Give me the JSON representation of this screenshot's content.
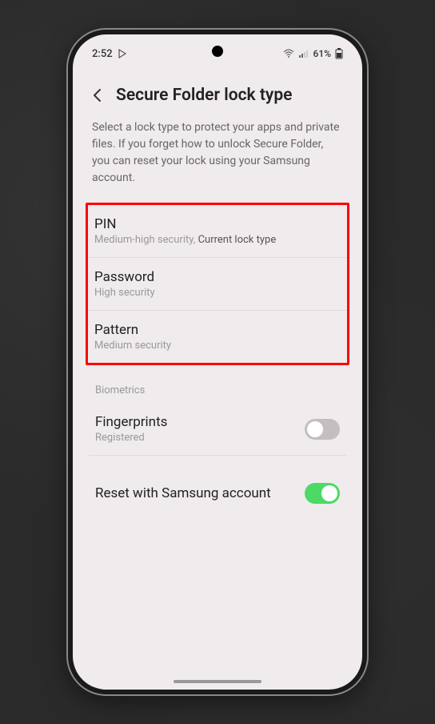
{
  "status_bar": {
    "time": "2:52",
    "battery_percent": "61%"
  },
  "header": {
    "title": "Secure Folder lock type"
  },
  "description": "Select a lock type to protect your apps and private files. If you forget how to unlock Secure Folder, you can reset your lock using your Samsung account.",
  "lock_options": [
    {
      "title": "PIN",
      "subtitle_security": "Medium-high security,",
      "subtitle_current": "Current lock type"
    },
    {
      "title": "Password",
      "subtitle_security": "High security",
      "subtitle_current": ""
    },
    {
      "title": "Pattern",
      "subtitle_security": "Medium security",
      "subtitle_current": ""
    }
  ],
  "biometrics": {
    "section_label": "Biometrics",
    "fingerprints": {
      "title": "Fingerprints",
      "subtitle": "Registered",
      "enabled": false
    }
  },
  "reset": {
    "title": "Reset with Samsung account",
    "enabled": true
  }
}
